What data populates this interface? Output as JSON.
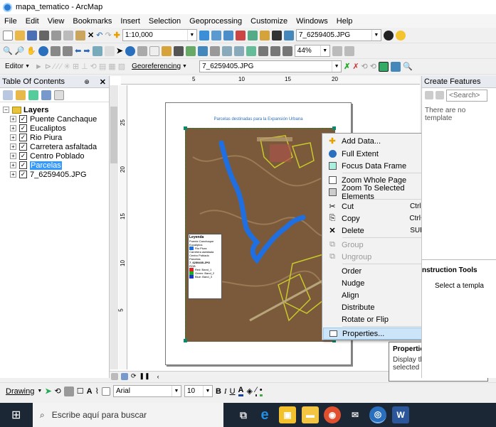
{
  "window": {
    "title": "mapa_tematico - ArcMap"
  },
  "menu": [
    "File",
    "Edit",
    "View",
    "Bookmarks",
    "Insert",
    "Selection",
    "Geoprocessing",
    "Customize",
    "Windows",
    "Help"
  ],
  "toolbar": {
    "scale": "1:10,000",
    "raster_layer": "7_6259405.JPG",
    "zoom": "44%",
    "editor": "Editor",
    "georeferencing": "Georeferencing",
    "georef_layer": "7_6259405.JPG"
  },
  "toc": {
    "title": "Table Of Contents",
    "group": "Layers",
    "layers": [
      "Puente Canchaque",
      "Eucaliptos",
      "Rio Piura",
      "Carretera asfaltada",
      "Centro Poblado",
      "Parcelas",
      "7_6259405.JPG"
    ],
    "selected": "Parcelas"
  },
  "ruler": {
    "h": [
      "5",
      "10",
      "15",
      "20"
    ],
    "v": [
      "25",
      "20",
      "15",
      "10",
      "5"
    ]
  },
  "map": {
    "page_title": "Parcelas destinadas para la Expansión Urbana",
    "legend_title": "Leyenda",
    "legend_items": [
      "Puente Canchaque",
      "Eucaliptos",
      "Rio Piura",
      "Carretera asfaltada",
      "Centro Poblado",
      "Parcelas",
      "7_6259405.JPG",
      "RGB",
      "Red: Band_1",
      "Green: Band_2",
      "Blue: Band_3"
    ]
  },
  "context_menu": {
    "items": [
      {
        "label": "Add Data...",
        "shortcut": "",
        "disabled": false,
        "submenu": false
      },
      {
        "label": "Full Extent",
        "shortcut": "",
        "disabled": false,
        "submenu": false
      },
      {
        "label": "Focus Data Frame",
        "shortcut": "",
        "disabled": false,
        "submenu": false
      },
      {
        "label": "Zoom Whole Page",
        "shortcut": "",
        "disabled": false,
        "submenu": false
      },
      {
        "label": "Zoom To Selected Elements",
        "shortcut": "",
        "disabled": false,
        "submenu": false
      },
      {
        "label": "Cut",
        "shortcut": "Ctrl+X",
        "disabled": false,
        "submenu": false
      },
      {
        "label": "Copy",
        "shortcut": "Ctrl+C",
        "disabled": false,
        "submenu": false
      },
      {
        "label": "Delete",
        "shortcut": "SUPR",
        "disabled": false,
        "submenu": false
      },
      {
        "label": "Group",
        "shortcut": "",
        "disabled": true,
        "submenu": false
      },
      {
        "label": "Ungroup",
        "shortcut": "",
        "disabled": true,
        "submenu": false
      },
      {
        "label": "Order",
        "shortcut": "",
        "disabled": false,
        "submenu": true
      },
      {
        "label": "Nudge",
        "shortcut": "",
        "disabled": false,
        "submenu": true
      },
      {
        "label": "Align",
        "shortcut": "",
        "disabled": false,
        "submenu": true
      },
      {
        "label": "Distribute",
        "shortcut": "",
        "disabled": false,
        "submenu": true
      },
      {
        "label": "Rotate or Flip",
        "shortcut": "",
        "disabled": false,
        "submenu": true
      },
      {
        "label": "Properties...",
        "shortcut": "",
        "disabled": false,
        "submenu": false
      }
    ]
  },
  "tooltip": {
    "title": "Properties",
    "body": "Display the properties for the selected element"
  },
  "right_pane": {
    "title": "Create Features",
    "search": "<Search>",
    "empty": "There are no template",
    "construction_title": "nstruction Tools",
    "construction_body": "Select a templa"
  },
  "drawing": {
    "label": "Drawing",
    "font": "Arial",
    "size": "10"
  },
  "taskbar": {
    "search_placeholder": "Escribe aquí para buscar"
  }
}
